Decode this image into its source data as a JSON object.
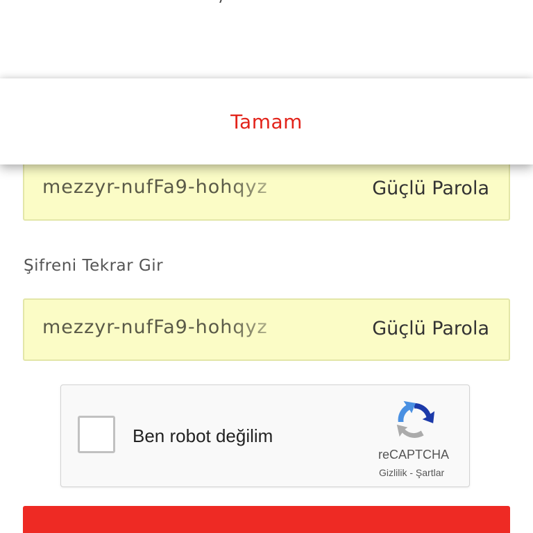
{
  "dialog": {
    "ok_label": "Tamam"
  },
  "password": {
    "value": "mezzyr-nufFa9-hohqyz",
    "strength": "Güçlü Parola"
  },
  "confirm_password": {
    "label": "Şifreni Tekrar Gir",
    "value": "mezzyr-nufFa9-hohqyz",
    "strength": "Güçlü Parola"
  },
  "recaptcha": {
    "checkbox_label": "Ben robot değilim",
    "brand": "reCAPTCHA",
    "privacy_link": "Gizlilik",
    "separator": " - ",
    "terms_link": "Şartlar",
    "checked": false
  },
  "colors": {
    "accent": "#e2231a",
    "field_bg": "#fbfcc6",
    "submit_bg": "#ee2a24"
  }
}
